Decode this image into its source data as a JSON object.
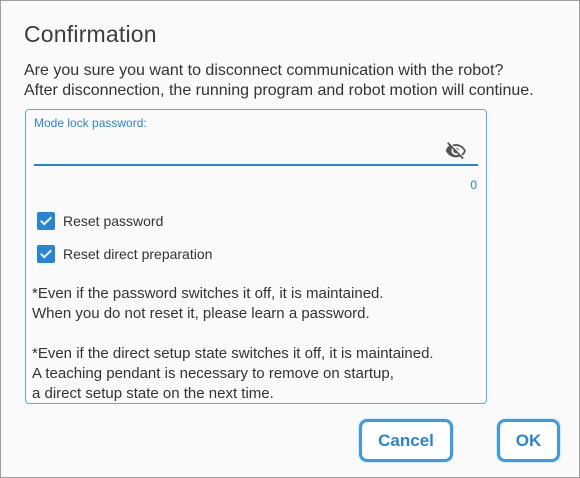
{
  "dialog": {
    "title": "Confirmation",
    "message_line1": "Are you sure you want to disconnect communication with the robot?",
    "message_line2": "After disconnection, the running program and robot motion will continue."
  },
  "password": {
    "label": "Mode lock password:",
    "value": "",
    "char_count": "0",
    "visibility_icon": "eye-off-icon"
  },
  "options": {
    "reset_password": {
      "label": "Reset password",
      "checked": true
    },
    "reset_direct_preparation": {
      "label": "Reset direct preparation",
      "checked": true
    }
  },
  "notes": {
    "note1_line1": "*Even if the password switches it off, it is maintained.",
    "note1_line2": "When you do not reset it, please learn a password.",
    "note2_line1": "*Even if the direct setup state switches it off, it is maintained.",
    "note2_line2": "A teaching pendant is necessary to remove on startup,",
    "note2_line3": "a direct setup state on the next time."
  },
  "buttons": {
    "cancel_label": "Cancel",
    "ok_label": "OK"
  },
  "colors": {
    "accent": "#2a84d6",
    "button_border": "#3d9be4",
    "panel_border": "#5aaae6",
    "text": "#333333"
  }
}
